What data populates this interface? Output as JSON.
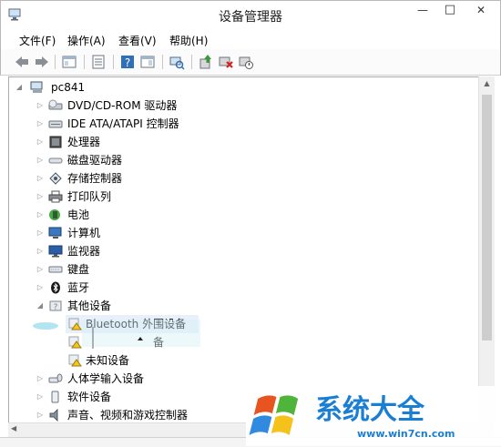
{
  "window": {
    "title": "设备管理器",
    "minimize": "—",
    "maximize": "□",
    "close": "✕"
  },
  "menu": [
    "文件(F)",
    "操作(A)",
    "查看(V)",
    "帮助(H)"
  ],
  "toolbar_icons": [
    "back-arrow-icon",
    "forward-arrow-icon",
    "console-tree-icon",
    "properties-icon",
    "help-icon",
    "action-pane-icon",
    "scan-hardware-icon",
    "update-driver-icon",
    "uninstall-icon",
    "disable-device-icon"
  ],
  "tree": {
    "root": "pc841",
    "items": [
      {
        "label": "DVD/CD-ROM 驱动器",
        "icon": "dvd-drive-icon"
      },
      {
        "label": "IDE ATA/ATAPI 控制器",
        "icon": "ide-controller-icon"
      },
      {
        "label": "处理器",
        "icon": "processor-icon"
      },
      {
        "label": "磁盘驱动器",
        "icon": "disk-drive-icon"
      },
      {
        "label": "存储控制器",
        "icon": "storage-controller-icon"
      },
      {
        "label": "打印队列",
        "icon": "printer-icon"
      },
      {
        "label": "电池",
        "icon": "battery-icon"
      },
      {
        "label": "计算机",
        "icon": "computer-icon"
      },
      {
        "label": "监视器",
        "icon": "monitor-icon"
      },
      {
        "label": "键盘",
        "icon": "keyboard-icon"
      },
      {
        "label": "蓝牙",
        "icon": "bluetooth-icon"
      },
      {
        "label": "其他设备",
        "icon": "other-devices-icon"
      }
    ],
    "other_children": [
      {
        "label": "Bluetooth 外围设备",
        "icon": "warning-device-icon"
      },
      {
        "label": "备",
        "icon": "warning-device-icon"
      },
      {
        "label": "未知设备",
        "icon": "warning-device-icon"
      }
    ],
    "items_after": [
      {
        "label": "人体学输入设备",
        "icon": "hid-icon"
      },
      {
        "label": "软件设备",
        "icon": "software-device-icon"
      },
      {
        "label": "声音、视频和游戏控制器",
        "icon": "sound-icon"
      }
    ]
  },
  "watermark": {
    "text": "系统大全",
    "url": "www.win7cn.com"
  },
  "colors": {
    "watermark_blue": "#1a7fd4",
    "warning_yellow": "#f3c623"
  }
}
